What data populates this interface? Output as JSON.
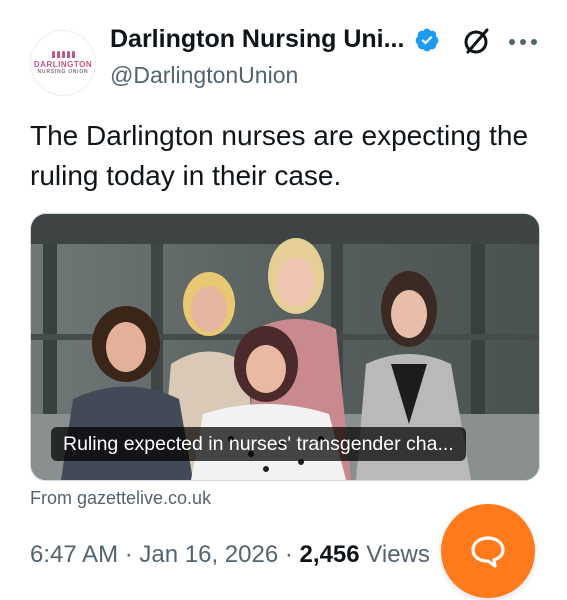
{
  "account": {
    "display_name": "Darlington Nursing Uni...",
    "handle": "@DarlingtonUnion",
    "verified": true,
    "avatar_text_line1": "DARLINGTON",
    "avatar_text_line2": "NURSING UNION"
  },
  "tweet": {
    "text": "The Darlington nurses are expecting the ruling today in their case."
  },
  "link_card": {
    "caption": "Ruling expected in nurses' transgender cha...",
    "source": "From gazettelive.co.uk"
  },
  "meta": {
    "time": "6:47 AM",
    "separator": "·",
    "date": "Jan 16, 2026",
    "views_count": "2,456",
    "views_label": "Views"
  },
  "icons": {
    "verified": "verified-badge-icon",
    "grok": "grok-icon",
    "more": "more-options-icon",
    "fab": "chat-bubble-icon"
  },
  "colors": {
    "accent_blue": "#1d9bf0",
    "fab_orange": "#ff7a1a",
    "muted_text": "#536471",
    "brand_pink": "#c0568a"
  }
}
